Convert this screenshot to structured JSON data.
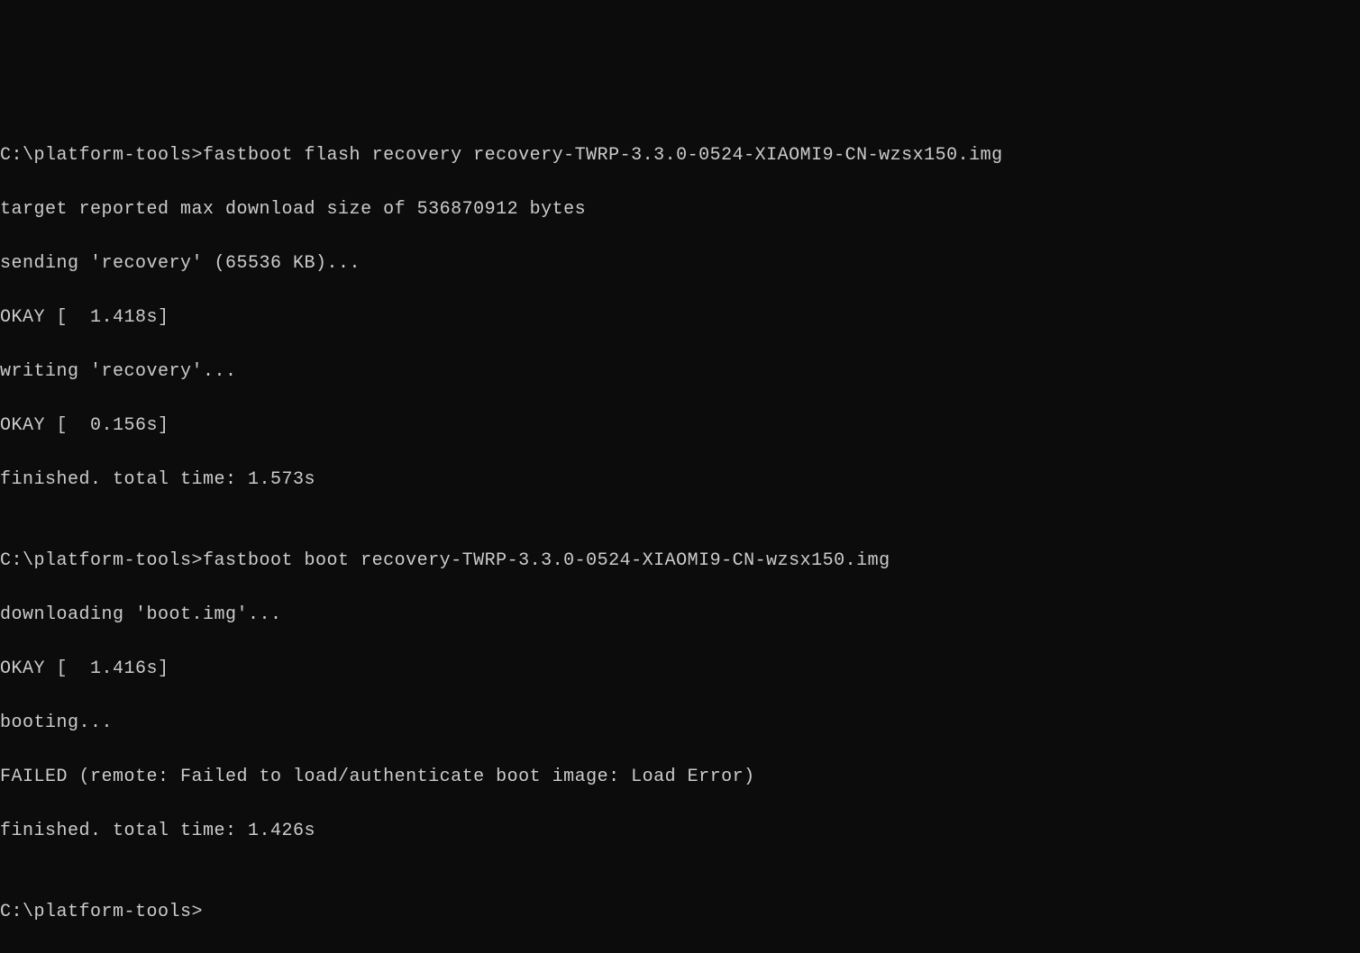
{
  "terminal": {
    "lines": [
      "C:\\platform-tools>fastboot flash recovery recovery-TWRP-3.3.0-0524-XIAOMI9-CN-wzsx150.img",
      "target reported max download size of 536870912 bytes",
      "sending 'recovery' (65536 KB)...",
      "OKAY [  1.418s]",
      "writing 'recovery'...",
      "OKAY [  0.156s]",
      "finished. total time: 1.573s",
      "",
      "C:\\platform-tools>fastboot boot recovery-TWRP-3.3.0-0524-XIAOMI9-CN-wzsx150.img",
      "downloading 'boot.img'...",
      "OKAY [  1.416s]",
      "booting...",
      "FAILED (remote: Failed to load/authenticate boot image: Load Error)",
      "finished. total time: 1.426s",
      "",
      "C:\\platform-tools>"
    ]
  }
}
